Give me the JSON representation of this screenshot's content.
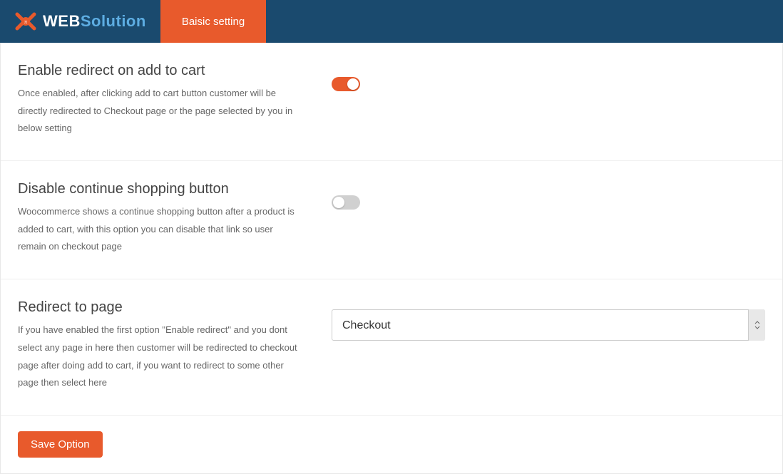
{
  "header": {
    "logo": {
      "part1": "WEB",
      "part2": "Solution"
    },
    "tab": "Baisic setting"
  },
  "settings": [
    {
      "title": "Enable redirect on add to cart",
      "description": "Once enabled, after clicking add to cart button customer will be directly redirected to Checkout page or the page selected by you in below setting",
      "type": "toggle",
      "value": true
    },
    {
      "title": "Disable continue shopping button",
      "description": "Woocommerce shows a continue shopping button after a product is added to cart, with this option you can disable that link so user remain on checkout page",
      "type": "toggle",
      "value": false
    },
    {
      "title": "Redirect to page",
      "description": "If you have enabled the first option \"Enable redirect\" and you dont select any page in here then customer will be redirected to checkout page after doing add to cart, if you want to redirect to some other page then select here",
      "type": "select",
      "value": "Checkout"
    }
  ],
  "footer": {
    "save_label": "Save Option"
  }
}
